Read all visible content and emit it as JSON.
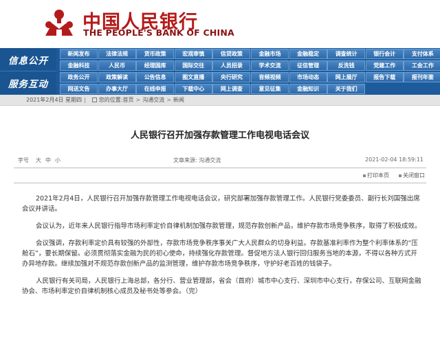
{
  "site": {
    "name_cn": "中国人民银行",
    "name_en": "THE PEOPLE'S BANK OF CHINA",
    "brand_color": "#b51a1a",
    "nav_bg": "#1d5b9c"
  },
  "nav": {
    "section1": "信息公开",
    "section2": "服务互动",
    "rows": [
      [
        "新闻发布",
        "法律法规",
        "货币政策",
        "宏观审慎",
        "信贷政策",
        "金融市场",
        "金融稳定",
        "调查统计",
        "银行会计",
        "支付体系"
      ],
      [
        "金融科技",
        "人民币",
        "经理国库",
        "国际交往",
        "人员招录",
        "学术交流",
        "征信管理",
        "反洗钱",
        "党建工作",
        "工会工作"
      ],
      [
        "政务公开",
        "政策解读",
        "公告信息",
        "图文直播",
        "央行研究",
        "音频视频",
        "市场动态",
        "网上展厅",
        "报告下载",
        "报刊年鉴"
      ],
      [
        "网送文告",
        "办事大厅",
        "在线申报",
        "下载中心",
        "网上调查",
        "意见征集",
        "金融知识",
        "关于我们"
      ]
    ]
  },
  "breadcrumb": {
    "date": "2021年2月4日 星期四",
    "location_label": "您的位置:",
    "items": [
      "首页",
      "沟通交流",
      "新闻"
    ]
  },
  "article": {
    "title": "人民银行召开加强存款管理工作电视电话会议",
    "font_size_label": "字号",
    "font_sizes": [
      "大",
      "中",
      "小"
    ],
    "source": "文章来源: 沟通交流",
    "date": "2021-02-04 18:59:11",
    "print_label": "打印本页",
    "close_label": "关闭窗口",
    "paragraphs": [
      "2021年2月4日，人民银行召开加强存款管理工作电视电话会议，研究部署加强存款管理工作。人民银行党委委员、副行长刘国强出席会议并讲话。",
      "会议认为，近年来人民银行指导市场利率定价自律机制加强存款管理，规范存款创新产品，维护存款市场竞争秩序，取得了积极成效。",
      "会议强调，存款利率定价具有较强的外部性，存款市场竞争秩序事关广大人民群众的切身利益。存款基准利率作为整个利率体系的“压舱石”，要长期保留。必须贯彻落实金融为民的初心使命，持续强化存款管理。督促地方法人银行回归服务当地的本源，不得以各种方式开办异地存款。继续加强对不规范存款创新产品的监测管理，维护存款市场竞争秩序，守护好老百姓的钱袋子。",
      "人民银行有关司局，人民银行上海总部，各分行、营业管理部，省会（首府）城市中心支行、深圳市中心支行，存保公司、互联网金融协会、市场利率定价自律机制核心成员及秘书处等参会。（完）"
    ]
  }
}
